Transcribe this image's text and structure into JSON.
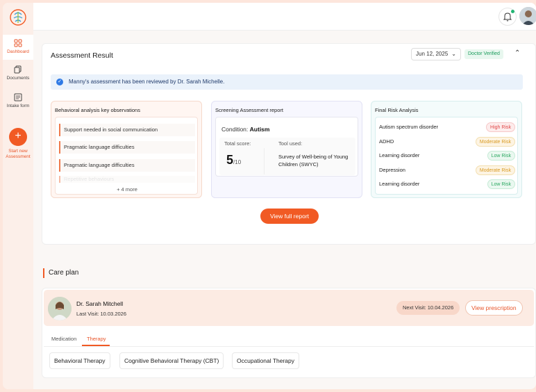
{
  "sidebar": {
    "items": [
      {
        "label": "Dashboard",
        "icon": "grid-icon",
        "active": true
      },
      {
        "label": "Documents",
        "icon": "documents-icon",
        "active": false
      },
      {
        "label": "Intake form",
        "icon": "intake-form-icon",
        "active": false
      }
    ],
    "new_assessment_icon": "+",
    "new_assessment_label_1": "Start new",
    "new_assessment_label_2": "Assessment"
  },
  "assessment": {
    "title": "Assessment Result",
    "date": "Jun 12, 2025",
    "verified_badge": "Doctor Verified",
    "notice": "Manny's assessment has been reviewed by Dr. Sarah Michelle.",
    "observations": {
      "title": "Behavioral analysis key observations",
      "items": [
        "Support needed in social communication",
        "Pragmatic language difficulties",
        "Pragmatic language difficulties",
        "Repetitive behaviours"
      ],
      "more": "+ 4 more"
    },
    "screening": {
      "title": "Screening Assessment report",
      "condition_label": "Condition:",
      "condition_value": "Autism",
      "total_score_label": "Total score:",
      "score": "5",
      "score_of": "/10",
      "tool_label": "Tool used:",
      "tool_value": "Survey of Well-being of Young Children (SWYC)"
    },
    "risk": {
      "title": "Final Risk Analysis",
      "rows": [
        {
          "name": "Autism spectrum disorder",
          "level": "High Risk",
          "kind": "high"
        },
        {
          "name": "ADHD",
          "level": "Moderate Risk",
          "kind": "mod"
        },
        {
          "name": "Learning disorder",
          "level": "Low Risk",
          "kind": "low"
        },
        {
          "name": "Depression",
          "level": "Moderate Risk",
          "kind": "mod"
        },
        {
          "name": "Learning disorder",
          "level": "Low Risk",
          "kind": "low"
        }
      ]
    },
    "view_full_report": "View full report"
  },
  "care_plan": {
    "title": "Care plan",
    "doctor_name": "Dr. Sarah Mitchell",
    "last_visit": "Last Visit: 10.03.2026",
    "next_visit": "Next Visit: 10.04.2026",
    "view_prescription": "View prescription",
    "tabs": [
      "Medication",
      "Therapy"
    ],
    "active_tab": "Therapy",
    "therapies": [
      "Behavioral Therapy",
      "Cognitive Behavioral Therapy (CBT)",
      "Occupational Therapy"
    ]
  },
  "colors": {
    "accent": "#f15a24",
    "verified": "#1a9c5b",
    "high_risk": "#e04848",
    "moderate_risk": "#d99a22",
    "low_risk": "#2aa860"
  }
}
